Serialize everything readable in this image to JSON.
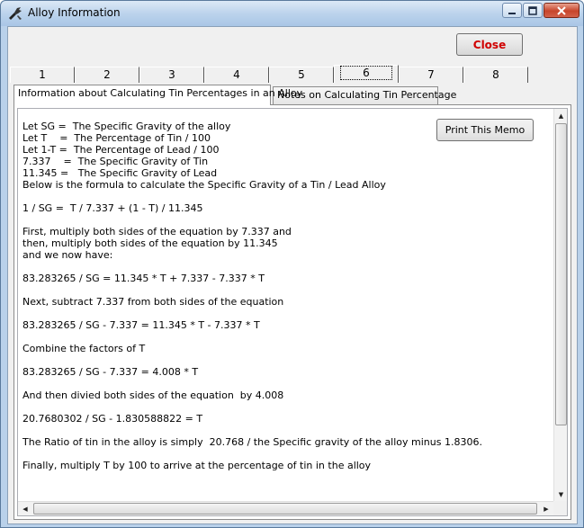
{
  "window": {
    "title": "Alloy Information",
    "icon": "wrench-app-icon",
    "controls": {
      "minimize": "minimize-icon",
      "maximize": "maximize-icon",
      "close": "close-x-icon"
    }
  },
  "toolbar": {
    "close_label": "Close"
  },
  "top_tabs": [
    {
      "label": "1",
      "active": false
    },
    {
      "label": "2",
      "active": false
    },
    {
      "label": "3",
      "active": false
    },
    {
      "label": "4",
      "active": false
    },
    {
      "label": "5",
      "active": false
    },
    {
      "label": "6",
      "active": true
    },
    {
      "label": "7",
      "active": false
    },
    {
      "label": "8",
      "active": false
    }
  ],
  "sub_tabs": [
    {
      "label": "Information about Calculating Tin Percentages in an Alloy",
      "active": true
    },
    {
      "label": "Notes on Calculating Tin Percentage",
      "active": false
    }
  ],
  "memo": {
    "print_label": "Print This Memo",
    "lines": [
      "Let SG =  The Specific Gravity of the alloy",
      "Let T    =  The Percentage of Tin / 100",
      "Let 1-T =  The Percentage of Lead / 100",
      "7.337    =  The Specific Gravity of Tin",
      "11.345 =   The Specific Gravity of Lead",
      "Below is the formula to calculate the Specific Gravity of a Tin / Lead Alloy",
      "",
      "1 / SG =  T / 7.337 + (1 - T) / 11.345",
      "",
      "First, multiply both sides of the equation by 7.337 and",
      "then, multiply both sides of the equation by 11.345",
      "and we now have:",
      "",
      "83.283265 / SG = 11.345 * T + 7.337 - 7.337 * T",
      "",
      "Next, subtract 7.337 from both sides of the equation",
      "",
      "83.283265 / SG - 7.337 = 11.345 * T - 7.337 * T",
      "",
      "Combine the factors of T",
      "",
      "83.283265 / SG - 7.337 = 4.008 * T",
      "",
      "And then divied both sides of the equation  by 4.008",
      "",
      "20.7680302 / SG - 1.830588822 = T",
      "",
      "The Ratio of tin in the alloy is simply  20.768 / the Specific gravity of the alloy minus 1.8306.",
      "",
      "Finally, multiply T by 100 to arrive at the percentage of tin in the alloy"
    ]
  }
}
